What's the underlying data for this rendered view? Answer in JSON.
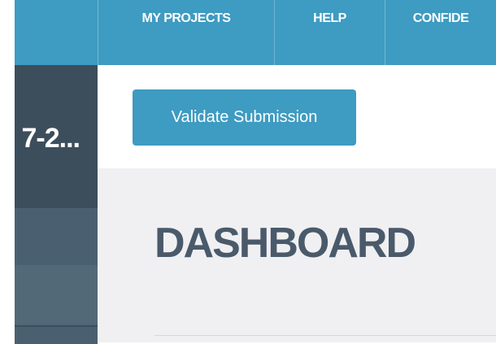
{
  "topnav": {
    "items": [
      {
        "label": "MY PROJECTS"
      },
      {
        "label": "HELP"
      },
      {
        "label": "CONFIDE"
      }
    ]
  },
  "sidebar": {
    "title": "7-2..."
  },
  "actions": {
    "validate_label": "Validate Submission"
  },
  "main": {
    "title": "DASHBOARD"
  },
  "colors": {
    "brand_blue": "#3e9bc1",
    "sidebar_dark": "#3c4e5c",
    "sidebar_mid": "#4e6576",
    "title_gray": "#4a5a6a",
    "content_bg": "#f0f0f3"
  }
}
